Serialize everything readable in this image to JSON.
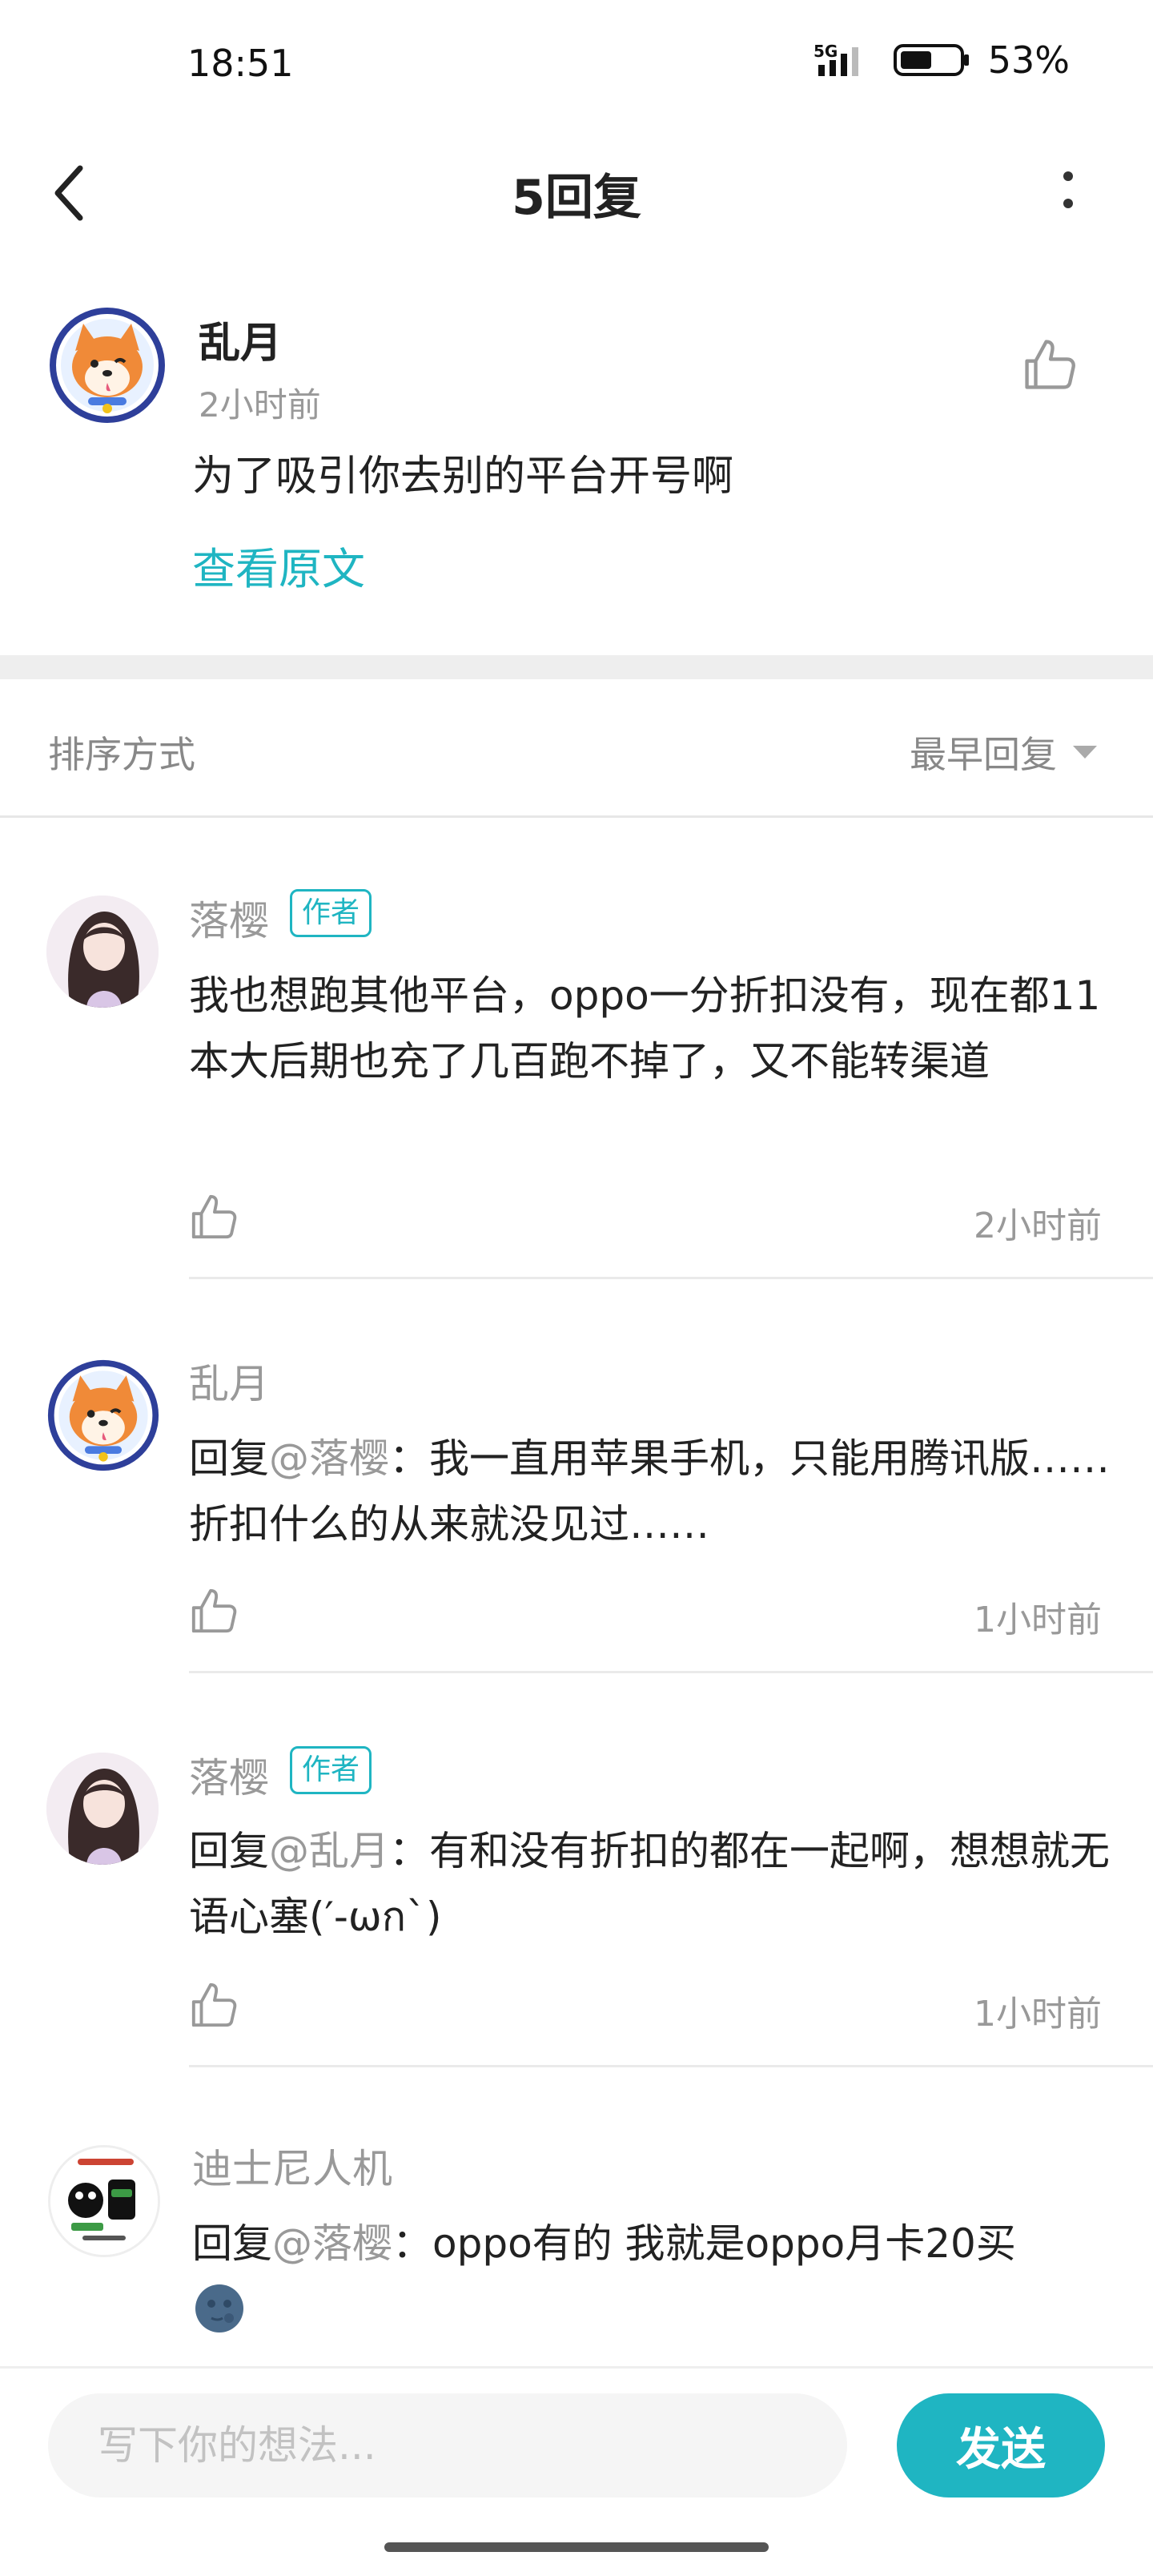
{
  "status_bar": {
    "time": "18:51",
    "network": "5G",
    "battery": "53%"
  },
  "header": {
    "title": "5回复"
  },
  "main_comment": {
    "user": "乱月",
    "time": "2小时前",
    "text": "为了吸引你去别的平台开号啊",
    "view_original": "查看原文"
  },
  "sort": {
    "label": "排序方式",
    "selected": "最早回复"
  },
  "replies": [
    {
      "user": "落樱",
      "badge": "作者",
      "text": "我也想跑其他平台，oppo一分折扣没有，现在都11本大后期也充了几百跑不掉了，又不能转渠道",
      "time": "2小时前"
    },
    {
      "user": "乱月",
      "reply_prefix": "回复",
      "mention": "@落樱",
      "text": "：我一直用苹果手机，只能用腾讯版……折扣什么的从来就没见过……",
      "time": "1小时前"
    },
    {
      "user": "落樱",
      "badge": "作者",
      "reply_prefix": "回复",
      "mention": "@乱月",
      "text": "：有和没有折扣的都在一起啊，想想就无语心塞(′-ωก`)",
      "time": "1小时前"
    },
    {
      "user": "迪士尼人机",
      "reply_prefix": "回复",
      "mention": "@落樱",
      "text": "：oppo有的  我就是oppo月卡20买"
    }
  ],
  "composer": {
    "placeholder": "写下你的想法...",
    "send_label": "发送"
  },
  "colors": {
    "accent": "#1fb5c2",
    "muted": "#999999"
  }
}
